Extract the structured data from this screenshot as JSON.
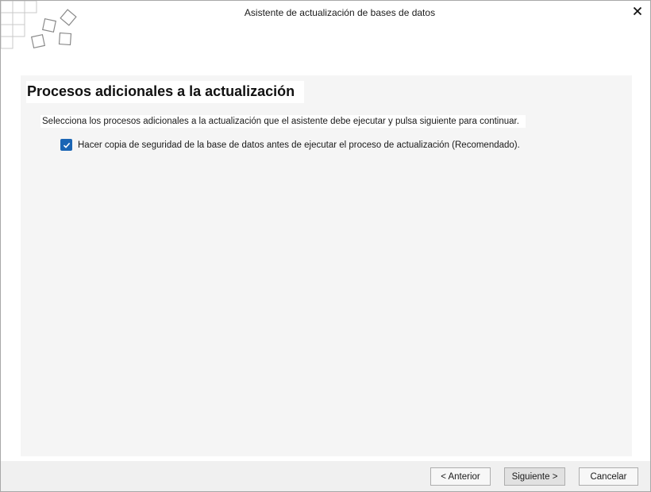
{
  "window": {
    "title": "Asistente de actualización de bases de datos",
    "close_icon": "close-icon"
  },
  "page": {
    "title": "Procesos adicionales a la actualización",
    "instructions": "Selecciona los procesos adicionales a la actualización que el asistente debe ejecutar y pulsa siguiente para continuar."
  },
  "options": [
    {
      "label": "Hacer copia de seguridad de la base de datos antes de ejecutar el proceso de actualización (Recomendado).",
      "checked": true
    }
  ],
  "footer": {
    "prev_label": "< Anterior",
    "next_label": "Siguiente >",
    "cancel_label": "Cancelar"
  },
  "colors": {
    "checkbox_accent": "#1a65b4",
    "content_bg": "#f5f5f5",
    "footer_bg": "#f0f0f0"
  }
}
